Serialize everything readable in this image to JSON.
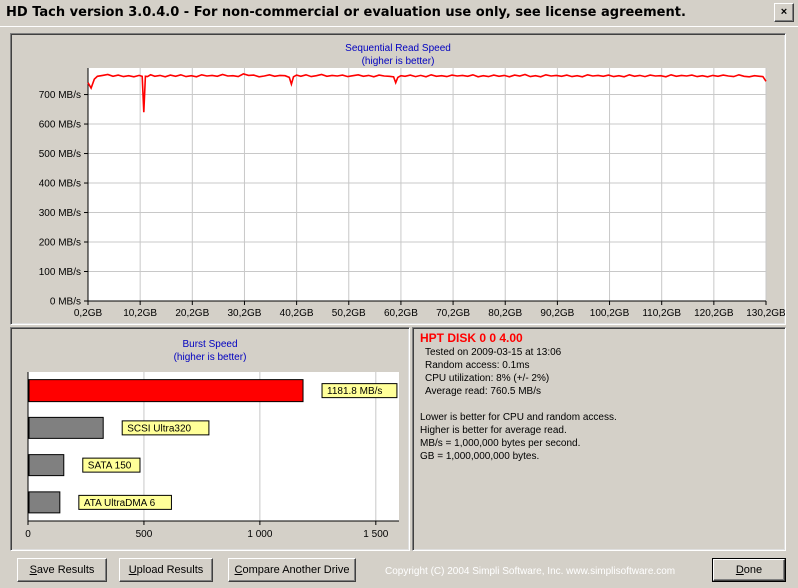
{
  "window": {
    "title": "HD Tach version 3.0.4.0  - For non-commercial or evaluation use only, see license agreement.",
    "close_label": "×"
  },
  "seq_chart": {
    "chart_data": {
      "type": "line",
      "title": "Sequential Read Speed",
      "subtitle": "(higher is better)",
      "y_unit": "MB/s",
      "x_unit": "GB",
      "xlim": [
        0.2,
        130.2
      ],
      "ylim": [
        0,
        790
      ],
      "y_ticks": [
        "0 MB/s",
        "100 MB/s",
        "200 MB/s",
        "300 MB/s",
        "400 MB/s",
        "500 MB/s",
        "600 MB/s",
        "700 MB/s"
      ],
      "y_tick_values": [
        0,
        100,
        200,
        300,
        400,
        500,
        600,
        700
      ],
      "x_ticks": [
        "0,2GB",
        "10,2GB",
        "20,2GB",
        "30,2GB",
        "40,2GB",
        "50,2GB",
        "60,2GB",
        "70,2GB",
        "80,2GB",
        "90,2GB",
        "100,2GB",
        "110,2GB",
        "120,2GB",
        "130,2GB"
      ],
      "x_tick_values": [
        0.2,
        10.2,
        20.2,
        30.2,
        40.2,
        50.2,
        60.2,
        70.2,
        80.2,
        90.2,
        100.2,
        110.2,
        120.2,
        130.2
      ],
      "series": [
        {
          "color": "#ff0000",
          "x": [
            0.2,
            0.8,
            1.4,
            2.0,
            3.0,
            4.0,
            5.0,
            6.0,
            7.0,
            8.0,
            9.0,
            10.0,
            10.6,
            10.9,
            11.2,
            11.6,
            12.2,
            13.0,
            14.0,
            15.0,
            16.0,
            17.0,
            18.0,
            19.0,
            20.0,
            21.0,
            22.0,
            23.0,
            24.0,
            25.0,
            26.0,
            27.0,
            28.0,
            29.0,
            30.0,
            31.0,
            32.0,
            33.0,
            34.0,
            35.0,
            36.0,
            37.0,
            38.0,
            38.8,
            39.2,
            39.6,
            40.2,
            41.0,
            42.0,
            43.0,
            44.0,
            45.0,
            46.0,
            47.0,
            48.0,
            49.0,
            50.0,
            51.0,
            52.0,
            53.0,
            54.0,
            55.0,
            56.0,
            57.0,
            58.0,
            58.8,
            59.2,
            59.6,
            60.2,
            61.0,
            62.0,
            63.0,
            64.0,
            65.0,
            66.0,
            67.0,
            68.0,
            69.0,
            70.0,
            71.0,
            72.0,
            73.0,
            74.0,
            75.0,
            76.0,
            77.0,
            78.0,
            79.0,
            80.0,
            81.0,
            82.0,
            83.0,
            84.0,
            85.0,
            86.0,
            87.0,
            88.0,
            89.0,
            90.0,
            91.0,
            92.0,
            93.0,
            94.0,
            95.0,
            96.0,
            97.0,
            98.0,
            99.0,
            100.0,
            101.0,
            102.0,
            103.0,
            104.0,
            105.0,
            106.0,
            107.0,
            108.0,
            109.0,
            110.0,
            111.0,
            112.0,
            113.0,
            114.0,
            115.0,
            116.0,
            117.0,
            118.0,
            119.0,
            120.0,
            121.0,
            122.0,
            123.0,
            124.0,
            125.0,
            126.0,
            127.0,
            128.0,
            129.0,
            129.6,
            130.2
          ],
          "y": [
            740,
            722,
            752,
            762,
            765,
            768,
            762,
            766,
            761,
            764,
            760,
            765,
            762,
            640,
            762,
            761,
            767,
            762,
            765,
            760,
            766,
            762,
            767,
            761,
            764,
            760,
            767,
            763,
            765,
            762,
            768,
            763,
            764,
            761,
            770,
            765,
            766,
            760,
            763,
            767,
            762,
            765,
            764,
            758,
            735,
            760,
            766,
            762,
            767,
            761,
            764,
            768,
            762,
            765,
            763,
            766,
            761,
            764,
            767,
            762,
            765,
            760,
            766,
            763,
            762,
            760,
            740,
            758,
            764,
            762,
            766,
            761,
            765,
            760,
            767,
            762,
            764,
            761,
            766,
            763,
            765,
            762,
            767,
            760,
            764,
            761,
            766,
            762,
            765,
            760,
            766,
            763,
            768,
            761,
            764,
            760,
            767,
            763,
            765,
            762,
            766,
            761,
            764,
            760,
            767,
            763,
            765,
            762,
            766,
            761,
            764,
            760,
            767,
            762,
            765,
            761,
            766,
            763,
            764,
            760,
            767,
            762,
            765,
            763,
            766,
            761,
            764,
            760,
            765,
            762,
            766,
            763,
            761,
            767,
            762,
            760,
            764,
            762,
            761,
            745,
            730
          ]
        }
      ]
    }
  },
  "burst_chart": {
    "chart_data": {
      "type": "bar",
      "orientation": "horizontal",
      "title": "Burst Speed",
      "subtitle": "(higher is better)",
      "xlim": [
        0,
        1600
      ],
      "x_ticks": [
        "0",
        "500",
        "1 000",
        "1 500"
      ],
      "x_tick_values": [
        0,
        500,
        1000,
        1500
      ],
      "categories": [
        "1181.8 MB/s",
        "SCSI Ultra320",
        "SATA 150",
        "ATA UltraDMA 6"
      ],
      "values": [
        1181.8,
        320,
        150,
        133
      ],
      "colors": [
        "#ff0000",
        "#808080",
        "#808080",
        "#808080"
      ],
      "label_color": "#ffff99"
    }
  },
  "results": {
    "drive_name": "HPT DISK 0 0 4.00",
    "tested_on": "Tested on 2009-03-15 at 13:06",
    "random_access": "Random access: 0.1ms",
    "cpu_utilization": "CPU utilization: 8% (+/- 2%)",
    "average_read": "Average read: 760.5 MB/s",
    "notes": [
      "Lower is better for CPU and random access.",
      "Higher is better for average read.",
      "MB/s = 1,000,000 bytes per second.",
      "GB = 1,000,000,000 bytes."
    ]
  },
  "buttons": {
    "save_key": "S",
    "save_rest": "ave Results",
    "upload_key": "U",
    "upload_rest": "pload Results",
    "compare_key": "C",
    "compare_rest": "ompare Another Drive",
    "done_key": "D",
    "done_rest": "one"
  },
  "footer": {
    "copyright": "Copyright (C) 2004 Simpli Software, Inc. www.simplisoftware.com"
  },
  "colors": {
    "window_bg": "#d4d0c8",
    "series_red": "#ff0000",
    "title_blue": "#0000c0",
    "drive_name_red": "#ff0000"
  }
}
